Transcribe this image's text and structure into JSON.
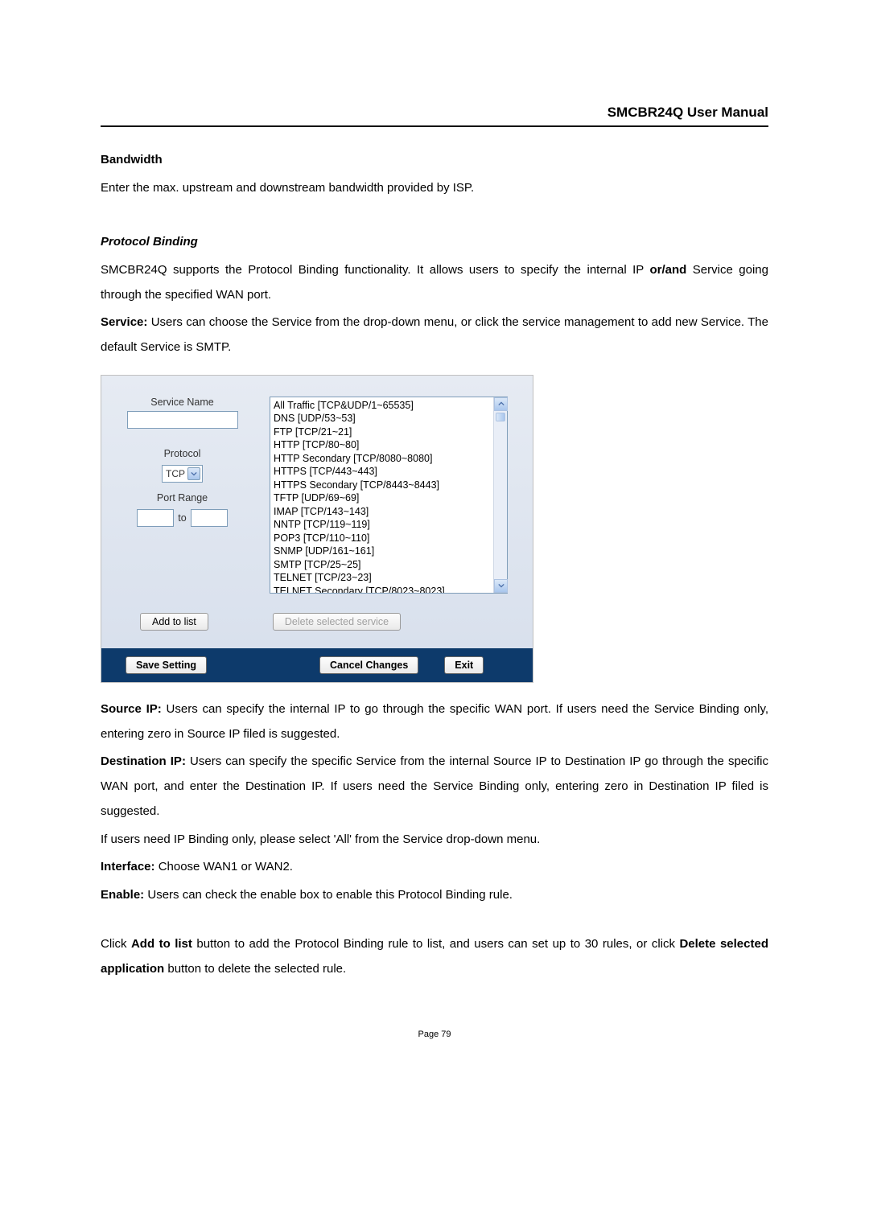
{
  "header": {
    "title": "SMCBR24Q User Manual"
  },
  "sections": {
    "bandwidth_heading": "Bandwidth",
    "bandwidth_text": "Enter the max. upstream and downstream bandwidth provided by ISP.",
    "protocol_binding_heading": "Protocol Binding",
    "pb_intro_1": "SMCBR24Q supports the Protocol Binding functionality. It allows users to specify the internal IP ",
    "pb_intro_bold": "or/and",
    "pb_intro_2": " Service going through the specified WAN port.",
    "service_label": "Service:",
    "service_text": " Users can choose the Service from the drop-down menu, or click the service management to add new Service. The default Service is SMTP.",
    "source_ip_label": "Source IP:",
    "source_ip_text": " Users can specify the internal IP to go through the specific WAN port. If users need the Service Binding only, entering zero in Source IP filed is suggested.",
    "dest_ip_label": "Destination IP:",
    "dest_ip_text": " Users can specify the specific Service from the internal Source IP to Destination IP go through the specific WAN port, and enter the Destination IP. If users need the Service Binding only, entering zero in Destination IP filed is suggested.",
    "ip_binding_text": "If users need IP Binding only, please select 'All' from the Service drop-down menu.",
    "interface_label": "Interface:",
    "interface_text": " Choose WAN1 or WAN2.",
    "enable_label": "Enable:",
    "enable_text": " Users can check the enable box to enable this Protocol Binding rule.",
    "click_prefix": "Click ",
    "add_to_list_bold": "Add to list",
    "click_mid": " button to add the Protocol Binding rule to list, and users can set up to 30 rules, or click ",
    "delete_bold": "Delete selected application",
    "click_suffix": " button to delete the selected rule."
  },
  "dialog": {
    "service_name_label": "Service Name",
    "protocol_label": "Protocol",
    "protocol_value": "TCP",
    "port_range_label": "Port Range",
    "port_to": "to",
    "list_items": [
      "All Traffic [TCP&UDP/1~65535]",
      "DNS [UDP/53~53]",
      "FTP [TCP/21~21]",
      "HTTP [TCP/80~80]",
      "HTTP Secondary [TCP/8080~8080]",
      "HTTPS [TCP/443~443]",
      "HTTPS Secondary [TCP/8443~8443]",
      "TFTP [UDP/69~69]",
      "IMAP [TCP/143~143]",
      "NNTP [TCP/119~119]",
      "POP3 [TCP/110~110]",
      "SNMP [UDP/161~161]",
      "SMTP [TCP/25~25]",
      "TELNET [TCP/23~23]",
      "TELNET Secondary [TCP/8023~8023]"
    ],
    "add_to_list_btn": "Add to list",
    "delete_btn": "Delete selected service",
    "save_btn": "Save Setting",
    "cancel_btn": "Cancel Changes",
    "exit_btn": "Exit"
  },
  "footer": {
    "page_label": "Page 79"
  }
}
